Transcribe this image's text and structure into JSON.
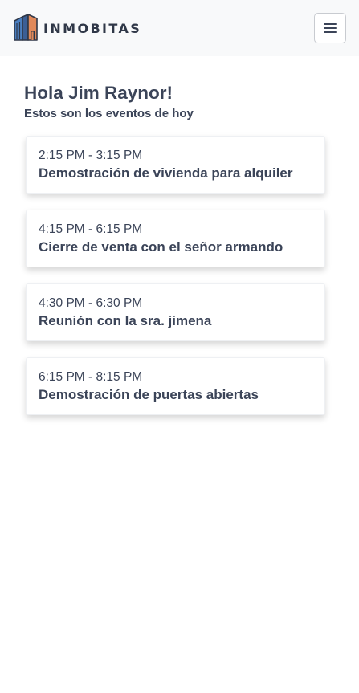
{
  "navbar": {
    "brand_name": "INMOBITAS",
    "logo_icon": "building-logo-icon",
    "menu_icon": "hamburger-menu-icon"
  },
  "greeting": {
    "title": "Hola Jim Raynor!",
    "subtitle": "Estos son los eventos de hoy"
  },
  "events": [
    {
      "time": "2:15 PM - 3:15 PM",
      "title": "Demostración de vivienda para alquiler"
    },
    {
      "time": "4:15 PM - 6:15 PM",
      "title": "Cierre de venta con el señor armando"
    },
    {
      "time": "4:30 PM - 6:30 PM",
      "title": "Reunión con la sra. jimena"
    },
    {
      "time": "6:15 PM - 8:15 PM",
      "title": "Demostración de puertas abiertas"
    }
  ],
  "colors": {
    "navbar_bg": "#f8f9fa",
    "text": "#3b4458",
    "logo_blue": "#4a7fc1",
    "logo_orange": "#e0895a",
    "logo_outline": "#2f3747"
  }
}
